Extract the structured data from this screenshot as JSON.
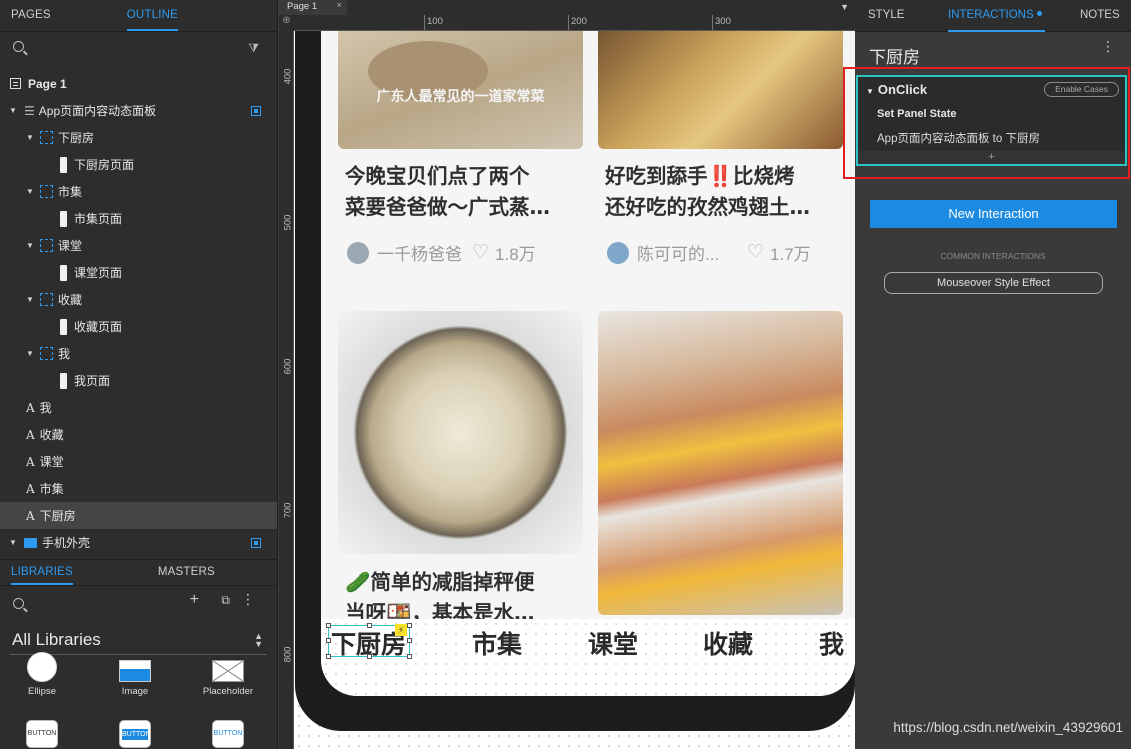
{
  "left_panel": {
    "tabs": [
      "PAGES",
      "OUTLINE"
    ],
    "outline": [
      {
        "label": "Page 1",
        "kind": "page",
        "indent": 0
      },
      {
        "label": "App页面内容动态面板",
        "kind": "dynamic-panel",
        "indent": 0
      },
      {
        "label": "下厨房",
        "kind": "state",
        "indent": 1
      },
      {
        "label": "下厨房页面",
        "kind": "image",
        "indent": 2
      },
      {
        "label": "市集",
        "kind": "state",
        "indent": 1
      },
      {
        "label": "市集页面",
        "kind": "image",
        "indent": 2
      },
      {
        "label": "课堂",
        "kind": "state",
        "indent": 1
      },
      {
        "label": "课堂页面",
        "kind": "image",
        "indent": 2
      },
      {
        "label": "收藏",
        "kind": "state",
        "indent": 1
      },
      {
        "label": "收藏页面",
        "kind": "image",
        "indent": 2
      },
      {
        "label": "我",
        "kind": "state",
        "indent": 1
      },
      {
        "label": "我页面",
        "kind": "image",
        "indent": 2
      },
      {
        "label": "我",
        "kind": "text",
        "indent": 0
      },
      {
        "label": "收藏",
        "kind": "text",
        "indent": 0
      },
      {
        "label": "课堂",
        "kind": "text",
        "indent": 0
      },
      {
        "label": "市集",
        "kind": "text",
        "indent": 0
      },
      {
        "label": "下厨房",
        "kind": "text",
        "indent": 0,
        "selected": true
      },
      {
        "label": "手机外壳",
        "kind": "folder",
        "indent": 0
      }
    ],
    "libraries_tabs": [
      "LIBRARIES",
      "MASTERS"
    ],
    "library_select": "All Libraries",
    "widgets": [
      "Ellipse",
      "Image",
      "Placeholder"
    ],
    "button_widgets": [
      "BUTTON",
      "BUTTON",
      "BUTTON"
    ]
  },
  "canvas": {
    "page_tab": "Page 1",
    "ruler_top": [
      "100",
      "200",
      "300"
    ],
    "ruler_left": [
      "400",
      "500",
      "600",
      "700",
      "800"
    ],
    "cards": [
      {
        "title_line1": "",
        "title_line2": "",
        "image_caption": "广东人最常见的一道家常菜",
        "author": "",
        "likes": ""
      },
      {
        "title_line1": "今晚宝贝们点了两个",
        "title_line2": "菜要爸爸做～广式蒸…",
        "author": "一千杨爸爸",
        "likes": "1.8万"
      },
      {
        "title_line1": "好吃到舔手‼️比烧烤",
        "title_line2": "还好吃的孜然鸡翅土…",
        "author": "陈可可的...",
        "likes": "1.7万"
      },
      {
        "title_line1": "🥒简单的减脂掉秤便",
        "title_line2": "当呀🍱，基本是水…",
        "author": "",
        "likes": ""
      }
    ],
    "nav": [
      "下厨房",
      "市集",
      "课堂",
      "收藏",
      "我"
    ]
  },
  "right_panel": {
    "tabs": [
      "STYLE",
      "INTERACTIONS",
      "NOTES"
    ],
    "widget_name": "下厨房",
    "event": "OnClick",
    "enable_cases": "Enable Cases",
    "action_title": "Set Panel State",
    "action_desc": "App页面内容动态面板 to 下厨房",
    "add_action": "+",
    "new_interaction": "New Interaction",
    "common_label": "COMMON INTERACTIONS",
    "common_button": "Mouseover Style Effect"
  },
  "watermark": "https://blog.csdn.net/weixin_43929601",
  "colors": {
    "accent": "#2e9bf0",
    "highlight_red": "#e21f1f",
    "highlight_cyan": "#2dc4c4"
  }
}
